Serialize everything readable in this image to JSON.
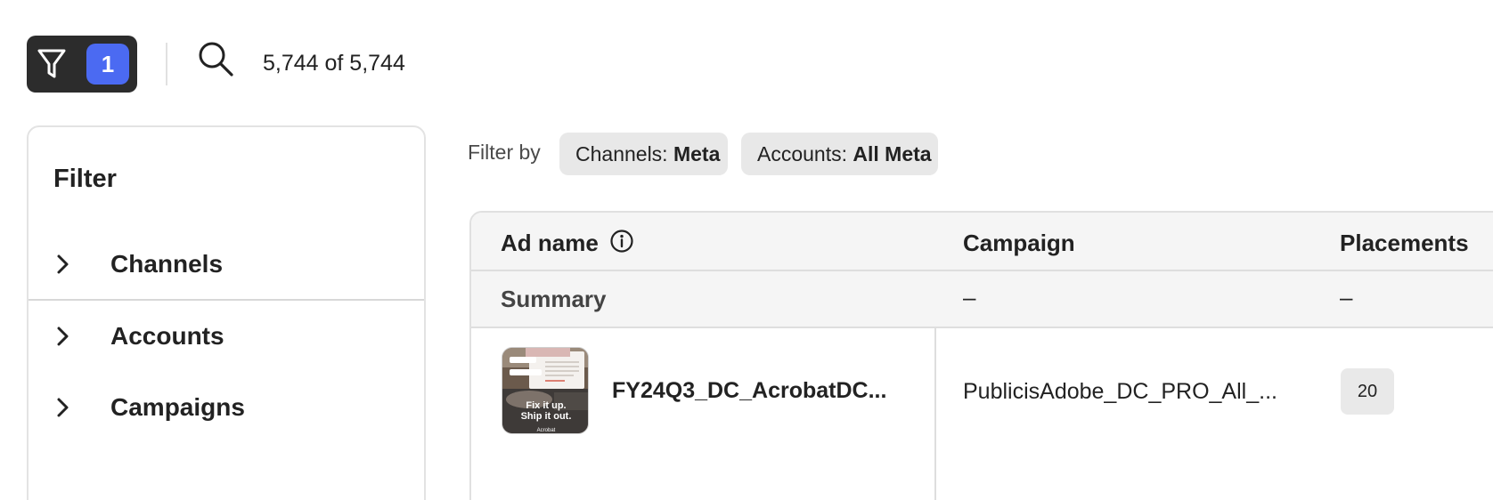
{
  "toolbar": {
    "active_filter_count": "1",
    "result_count": "5,744 of 5,744"
  },
  "filter_panel": {
    "title": "Filter",
    "sections": [
      {
        "label": "Channels"
      },
      {
        "label": "Accounts"
      },
      {
        "label": "Campaigns"
      }
    ]
  },
  "filter_by": {
    "label": "Filter by",
    "chips": [
      {
        "key": "Channels: ",
        "value": "Meta"
      },
      {
        "key": "Accounts: ",
        "value": "All Meta"
      }
    ]
  },
  "table": {
    "columns": [
      "Ad name",
      "Campaign",
      "Placements"
    ],
    "summary": {
      "label": "Summary",
      "campaign": "–",
      "placements": "–"
    },
    "rows": [
      {
        "ad_name": "FY24Q3_DC_AcrobatDC...",
        "campaign": "PublicisAdobe_DC_PRO_All_...",
        "placements": "20",
        "thumbnail": {
          "line1": "Fix it up.",
          "line2": "Ship it out.",
          "brand": "Acrobat"
        }
      }
    ]
  },
  "colors": {
    "toolbar_dark": "#2c2c2c",
    "badge_blue": "#4b6af2",
    "chip_bg": "#e8e8e8",
    "row_header_bg": "#f5f5f5"
  }
}
